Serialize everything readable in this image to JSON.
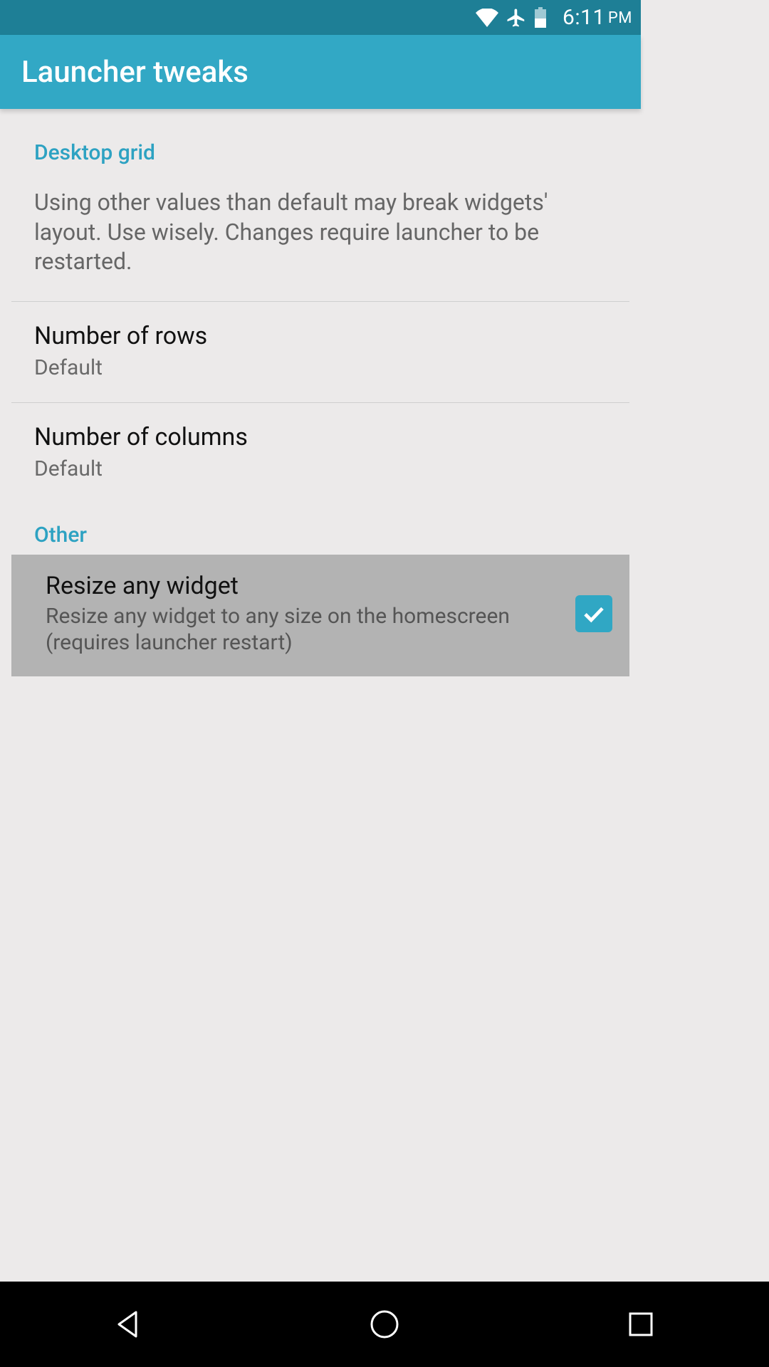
{
  "status": {
    "time": "6:11",
    "ampm": "PM"
  },
  "appbar": {
    "title": "Launcher tweaks"
  },
  "sections": {
    "grid_header": "Desktop grid",
    "grid_desc": "Using other values than default may break widgets' layout. Use wisely. Changes require launcher to be restarted.",
    "rows_title": "Number of rows",
    "rows_value": "Default",
    "cols_title": "Number of columns",
    "cols_value": "Default",
    "other_header": "Other",
    "resize_title": "Resize any widget",
    "resize_desc": "Resize any widget to any size on the homescreen (requires launcher restart)"
  }
}
